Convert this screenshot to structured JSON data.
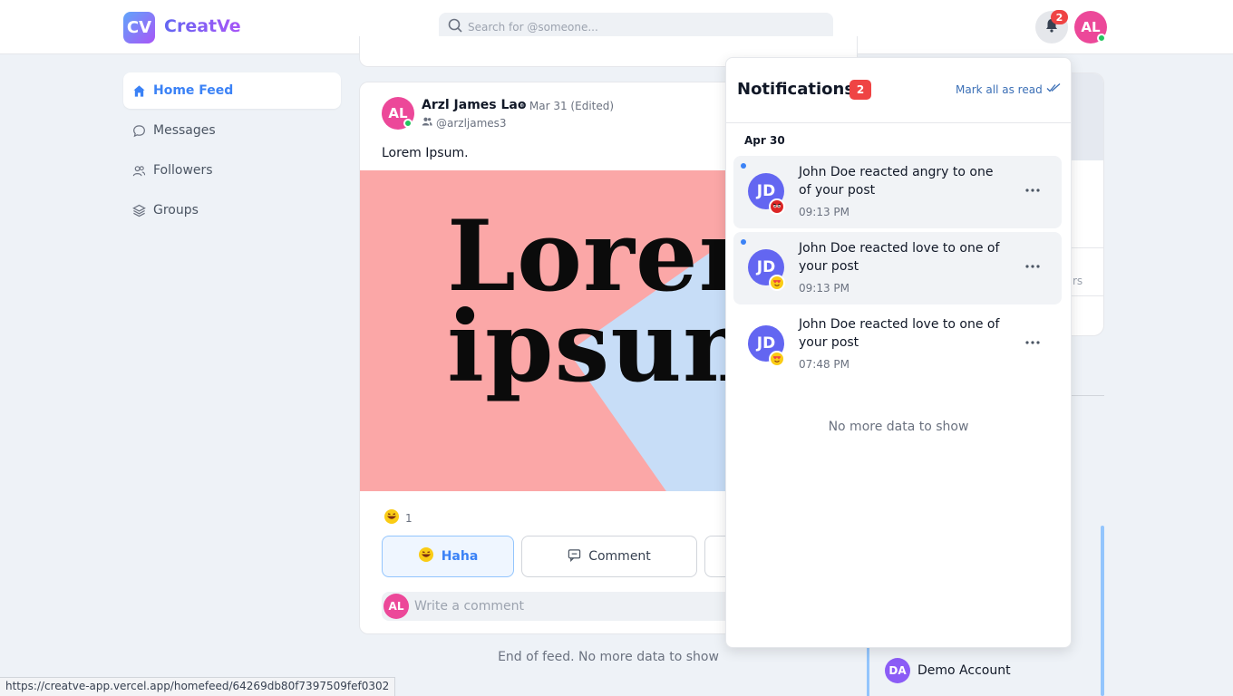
{
  "header": {
    "logo_text": "CV",
    "brand": "CreatVe",
    "search_placeholder": "Search for @someone...",
    "notification_badge": "2",
    "user_initials": "AL"
  },
  "sidebar": {
    "items": [
      {
        "label": "Home Feed",
        "icon": "home-icon",
        "active": true
      },
      {
        "label": "Messages",
        "icon": "chat-icon",
        "active": false
      },
      {
        "label": "Followers",
        "icon": "users-icon",
        "active": false
      },
      {
        "label": "Groups",
        "icon": "layers-icon",
        "active": false
      }
    ]
  },
  "post": {
    "author_initials": "AL",
    "author": "Arzl James Lao",
    "meta": "• Mar 31 (Edited)",
    "handle": "@arzljames3",
    "text": "Lorem Ipsum.",
    "image_line1": "Lorem",
    "image_line2": "ipsum",
    "reaction_count": "1",
    "haha_label": "Haha",
    "comment_label": "Comment",
    "comment_placeholder": "Write a comment",
    "commenter_initials": "AL"
  },
  "feed_end": "End of feed. No more data to show",
  "right": {
    "cut_text": "rs",
    "demo_initials": "DA",
    "demo_name": "Demo Account"
  },
  "notifications": {
    "title": "Notifications",
    "count": "2",
    "mark_all": "Mark all as read",
    "date": "Apr 30",
    "items": [
      {
        "initials": "JD",
        "text": "John Doe reacted angry to one of your post",
        "time": "09:13 PM",
        "reaction": "angry",
        "unread": true
      },
      {
        "initials": "JD",
        "text": "John Doe reacted love to one of your post",
        "time": "09:13 PM",
        "reaction": "love",
        "unread": true
      },
      {
        "initials": "JD",
        "text": "John Doe reacted love to one of your post",
        "time": "07:48 PM",
        "reaction": "love",
        "unread": false
      }
    ],
    "no_more": "No more data to show"
  },
  "status_url": "https://creatve-app.vercel.app/homefeed/64269db80f7397509fef0302",
  "colors": {
    "accent": "#3b82f6",
    "badge": "#ef4444",
    "user_avatar": "#ec4899",
    "notifier_avatar": "#6366f1",
    "demo_avatar": "#8b5cf6"
  }
}
